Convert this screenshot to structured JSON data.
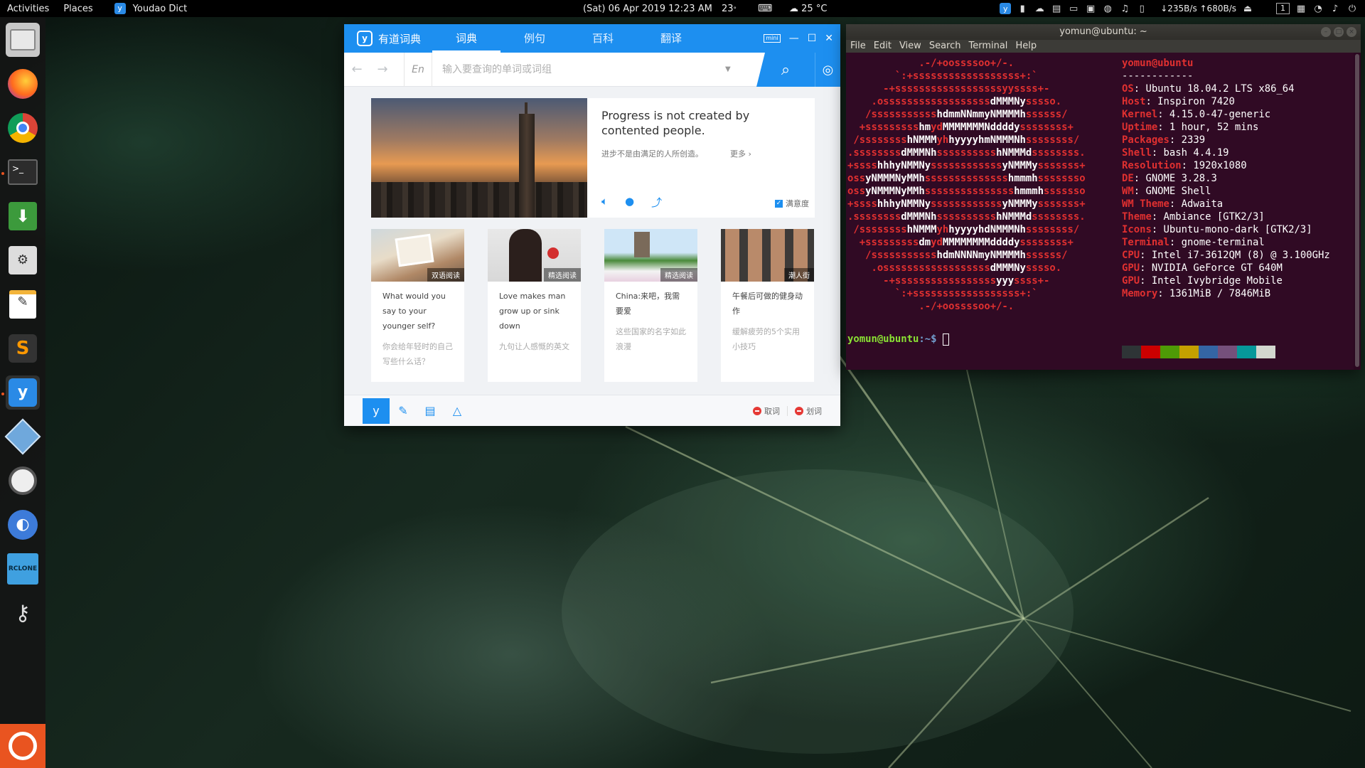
{
  "topbar": {
    "activities": "Activities",
    "places": "Places",
    "app_name": "Youdao Dict",
    "clock": "(Sat) 06 Apr 2019 12:23 AM",
    "temp_cpu": "23",
    "temp_cpu_unit": "°",
    "weather": "25 °C",
    "net_speed": "↓235B/s ↑680B/s",
    "workspace": "1"
  },
  "dock": {
    "items": [
      "files-icon",
      "firefox-icon",
      "chrome-icon",
      "terminal-icon",
      "download-manager-icon",
      "mixer-icon",
      "text-editor-icon",
      "sublime-text-icon",
      "youdao-dict-icon",
      "virtualbox-icon",
      "video-tool-icon",
      "hedgehog-icon",
      "rclone-icon",
      "keys-icon"
    ],
    "apps_button": "ubuntu-apps-icon"
  },
  "youdao": {
    "title": "有道词典",
    "tabs": [
      "词典",
      "例句",
      "百科",
      "翻译"
    ],
    "active_tab": 0,
    "mini_label": "mini",
    "lang": "En",
    "search_placeholder": "输入要查询的单词或词组",
    "daily": {
      "quote_en": "Progress is not created by contented people.",
      "quote_cn": "进步不是由满足的人所创造。",
      "more": "更多 ›",
      "satisfy": "满意度"
    },
    "cards": [
      {
        "tag": "双语阅读",
        "title": "What would you say to your younger self?",
        "sub": "你会给年轻时的自己写些什么话？"
      },
      {
        "tag": "精选阅读",
        "title": "Love makes man grow up or sink down",
        "sub": "九句让人感慨的英文"
      },
      {
        "tag": "精选阅读",
        "title": "China:来吧，我需要爱",
        "sub": "这些国家的名字如此浪漫"
      },
      {
        "tag": "潮人街",
        "title": "午餐后可做的健身动作",
        "sub": "缓解疲劳的5个实用小技巧"
      }
    ],
    "bottom": {
      "quci": "取词",
      "huaci": "划词"
    }
  },
  "terminal": {
    "title": "yomun@ubuntu: ~",
    "menu": [
      "File",
      "Edit",
      "View",
      "Search",
      "Terminal",
      "Help"
    ],
    "logo_lines": [
      "            .-/+oossssoo+/-.",
      "        `:+ssssssssssssssssss+:`",
      "      -+ssssssssssssssssssyyssss+-",
      "    .ossssssssssssssssss|dMMMNy|sssso.",
      "   /sssssssssss|hdmmNNmmyNMMMMh|ssssss/",
      "  +sssssssss|hm|yd|MMMMMMMNddddy|ssssssss+",
      " /ssssssss|hNMMM|yh|hyyyyhmNMMMNh|ssssssss/",
      ".ssssssss|dMMMNh|ssssssssss|hNMMMd|ssssssss.",
      "+ssss|hhhyNMMNy|ssssssssssss|yNMMMy|sssssss+",
      "oss|yNMMMNyMMh|ssssssssssssss|hmmmh|ssssssso",
      "oss|yNMMMNyMMh|sssssssssssssss|hmmmh|sssssso",
      "+ssss|hhhyNMMNy|ssssssssssss|yNMMMy|sssssss+",
      ".ssssssss|dMMMNh|ssssssssss|hNMMMd|ssssssss.",
      " /ssssssss|hNMMM|yh|hyyyyhdNMMMNh|ssssssss/",
      "  +sssssssss|dm|yd|MMMMMMMMddddy|ssssssss+",
      "   /sssssssssss|hdmNNNNmyNMMMMh|ssssss/",
      "    .ossssssssssssssssss|dMMMNy|sssso.",
      "      -+sssssssssssssssss|yyy|ssss+-",
      "        `:+ssssssssssssssssss+:`",
      "            .-/+oossssoo+/-."
    ],
    "info_header": "yomun@ubuntu",
    "info_sep": "------------",
    "info": [
      {
        "k": "OS",
        "v": "Ubuntu 18.04.2 LTS x86_64"
      },
      {
        "k": "Host",
        "v": "Inspiron 7420"
      },
      {
        "k": "Kernel",
        "v": "4.15.0-47-generic"
      },
      {
        "k": "Uptime",
        "v": "1 hour, 52 mins"
      },
      {
        "k": "Packages",
        "v": "2339"
      },
      {
        "k": "Shell",
        "v": "bash 4.4.19"
      },
      {
        "k": "Resolution",
        "v": "1920x1080"
      },
      {
        "k": "DE",
        "v": "GNOME 3.28.3"
      },
      {
        "k": "WM",
        "v": "GNOME Shell"
      },
      {
        "k": "WM Theme",
        "v": "Adwaita"
      },
      {
        "k": "Theme",
        "v": "Ambiance [GTK2/3]"
      },
      {
        "k": "Icons",
        "v": "Ubuntu-mono-dark [GTK2/3]"
      },
      {
        "k": "Terminal",
        "v": "gnome-terminal"
      },
      {
        "k": "CPU",
        "v": "Intel i7-3612QM (8) @ 3.100GHz"
      },
      {
        "k": "GPU",
        "v": "NVIDIA GeForce GT 640M"
      },
      {
        "k": "GPU",
        "v": "Intel Ivybridge Mobile"
      },
      {
        "k": "Memory",
        "v": "1361MiB / 7846MiB"
      }
    ],
    "palette": [
      "#2e3436",
      "#cc0000",
      "#4e9a06",
      "#c4a000",
      "#3465a4",
      "#75507b",
      "#06989a",
      "#d3d7cf"
    ],
    "prompt_user": "yomun@ubuntu",
    "prompt_path": ":~$ "
  }
}
